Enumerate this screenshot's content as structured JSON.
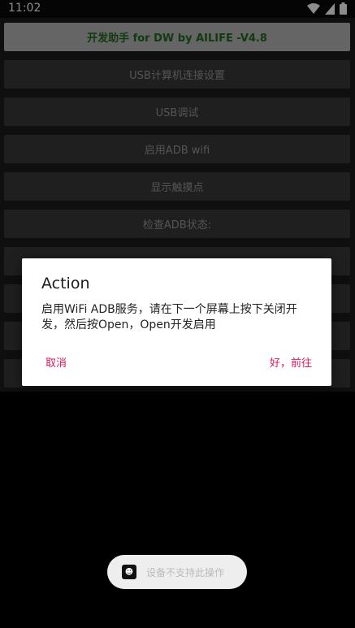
{
  "status_bar": {
    "time": "11:02"
  },
  "app": {
    "title_button": "开发助手 for DW by AILIFE -V4.8",
    "buttons": [
      "USB计算机连接设置",
      "USB调试",
      "启用ADB wifi",
      "显示触摸点",
      "检查ADB状态:"
    ]
  },
  "dialog": {
    "title": "Action",
    "message": "启用WiFi ADB服务，请在下一个屏幕上按下关闭开发，然后按Open，Open开发启用",
    "cancel_label": "取消",
    "ok_label": "好，前往"
  },
  "toast": {
    "text": "设备不支持此操作"
  },
  "colors": {
    "accent": "#d81b60",
    "title_text": "#1f6b1f"
  }
}
